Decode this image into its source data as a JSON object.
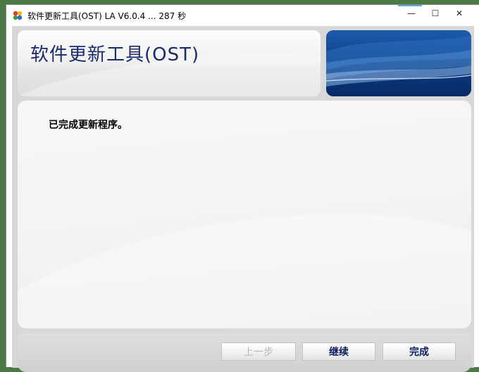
{
  "window": {
    "title": "软件更新工具(OST) LA V6.0.4 ... 287 秒",
    "min_glyph": "—",
    "max_glyph": "☐",
    "close_glyph": "✕"
  },
  "header": {
    "title": "软件更新工具(OST)"
  },
  "main": {
    "message": "已完成更新程序。"
  },
  "footer": {
    "prev_label": "上一步",
    "continue_label": "继续",
    "finish_label": "完成"
  },
  "colors": {
    "title_color": "#1b2a6e",
    "banner_blue": "#0c3a7f",
    "button_text": "#0b1b5e"
  }
}
